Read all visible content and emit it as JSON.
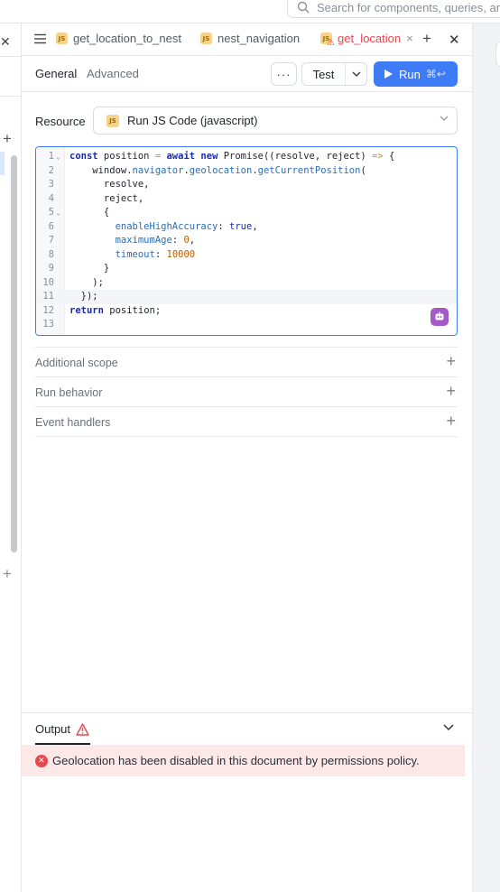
{
  "search": {
    "placeholder": "Search for components, queries, and"
  },
  "tabs": [
    {
      "label": "get_location_to_nest",
      "active": false
    },
    {
      "label": "nest_navigation",
      "active": false
    },
    {
      "label": "get_location",
      "active": true
    }
  ],
  "subtabs": {
    "general": "General",
    "advanced": "Advanced"
  },
  "toolbar": {
    "more": "···",
    "test": "Test",
    "run": "Run",
    "run_shortcut": "⌘↩"
  },
  "resource": {
    "label": "Resource",
    "value": "Run JS Code (javascript)",
    "badge": "JS"
  },
  "editor": {
    "highlighted_line": 11,
    "lines": [
      {
        "n": "1",
        "fold": true
      },
      {
        "n": "2",
        "fold": false
      },
      {
        "n": "3",
        "fold": false
      },
      {
        "n": "4",
        "fold": false
      },
      {
        "n": "5",
        "fold": true
      },
      {
        "n": "6",
        "fold": false
      },
      {
        "n": "7",
        "fold": false
      },
      {
        "n": "8",
        "fold": false
      },
      {
        "n": "9",
        "fold": false
      },
      {
        "n": "10",
        "fold": false
      },
      {
        "n": "11",
        "fold": false
      },
      {
        "n": "12",
        "fold": false
      },
      {
        "n": "13",
        "fold": false
      }
    ]
  },
  "sections": [
    {
      "title": "Additional scope"
    },
    {
      "title": "Run behavior"
    },
    {
      "title": "Event handlers"
    }
  ],
  "output": {
    "title": "Output",
    "error": "Geolocation has been disabled in this document by permissions policy."
  },
  "colors": {
    "accent": "#3e7bf6",
    "error": "#e5484d",
    "error_bg": "#fde8e8",
    "js_badge": "#f5d38a"
  }
}
